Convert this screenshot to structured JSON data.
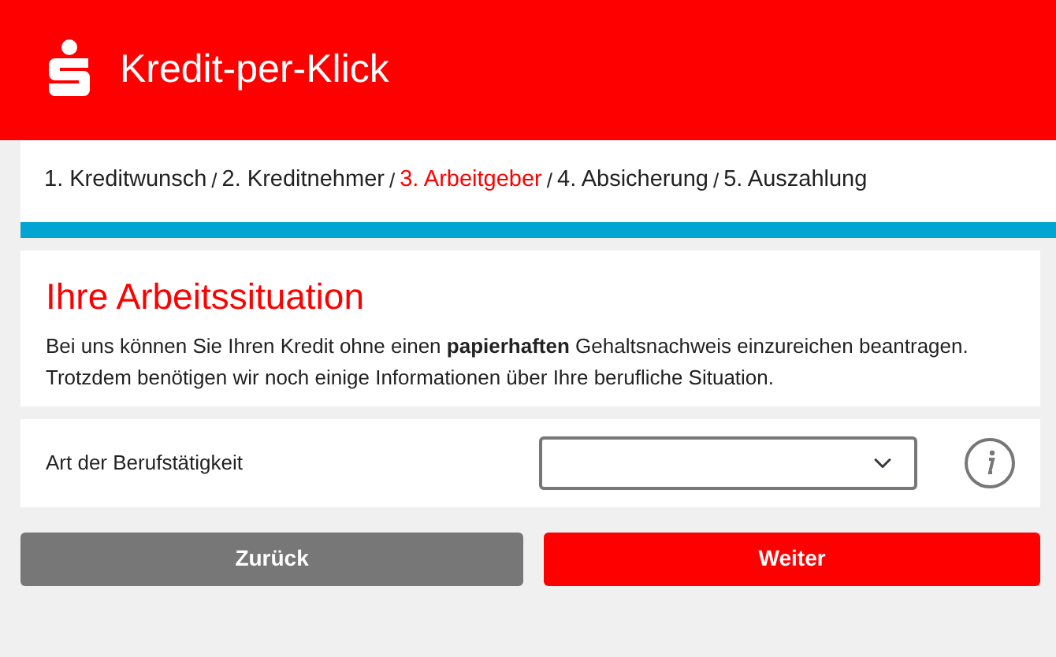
{
  "header": {
    "title": "Kredit-per-Klick"
  },
  "steps": [
    {
      "label": "1. Kreditwunsch",
      "selected": false,
      "separator": "/"
    },
    {
      "label": "2. Kreditnehmer",
      "selected": false,
      "separator": "/"
    },
    {
      "label": "3. Arbeitgeber",
      "selected": true,
      "separator": "/"
    },
    {
      "label": "4. Absicherung",
      "selected": false,
      "separator": "/"
    },
    {
      "label": "5. Auszahlung",
      "selected": false
    }
  ],
  "intro": {
    "heading": "Ihre Arbeitssituation",
    "text": "Bei uns können Sie Ihren Kredit ohne einen **papierhaften** Gehaltsnachweis einzureichen beantragen. Trotzdem benötigen wir noch einige Informationen über Ihre berufliche Situation."
  },
  "field": {
    "label": "Art der Berufstätigkeit"
  },
  "buttons": [
    {
      "label": "Zurück",
      "kind": "back"
    },
    {
      "label": "Weiter",
      "kind": "next"
    }
  ]
}
